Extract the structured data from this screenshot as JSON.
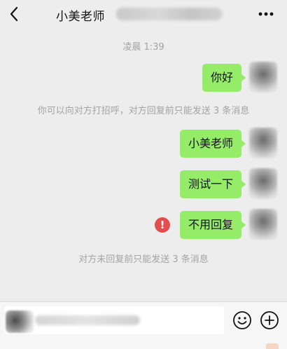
{
  "header": {
    "title": "小美老师",
    "back_icon": "chevron-left-icon",
    "more_icon": "more-dots-icon"
  },
  "chat": {
    "timestamp": "凌晨 1:39",
    "messages": [
      {
        "text": "你好",
        "status": "sent"
      },
      {
        "text": "小美老师",
        "status": "sent"
      },
      {
        "text": "测试一下",
        "status": "sent"
      },
      {
        "text": "不用回复",
        "status": "failed"
      }
    ],
    "system_notices": [
      "你可以向对方打招呼，对方回复前只能发送 3 条消息",
      "对方未回复前只能发送 3 条消息"
    ]
  },
  "composer": {
    "emoji_icon": "emoji-icon",
    "add_icon": "plus-circle-icon"
  },
  "colors": {
    "bubble": "#95ec69",
    "background": "#ededed",
    "error": "#e34d4d"
  }
}
